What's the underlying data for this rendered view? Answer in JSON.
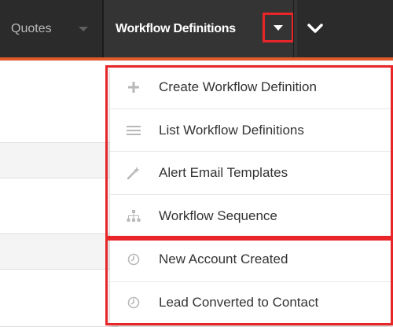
{
  "nav": {
    "tabs": [
      {
        "label": "Quotes"
      },
      {
        "label": "Workflow Definitions"
      }
    ]
  },
  "menu": {
    "items": [
      {
        "label": "Create Workflow Definition",
        "icon": "plus-icon"
      },
      {
        "label": "List Workflow Definitions",
        "icon": "list-icon"
      },
      {
        "label": "Alert Email Templates",
        "icon": "magic-wand-icon"
      },
      {
        "label": "Workflow Sequence",
        "icon": "sitemap-icon"
      }
    ],
    "recent": [
      {
        "label": "New Account Created",
        "icon": "clock-icon"
      },
      {
        "label": "Lead Converted to Contact",
        "icon": "clock-icon"
      }
    ]
  },
  "colors": {
    "nav_bg": "#2b2b2b",
    "active_tab_bg": "#343434",
    "accent_line": "#e05a2a",
    "highlight_border": "#e8262a"
  }
}
